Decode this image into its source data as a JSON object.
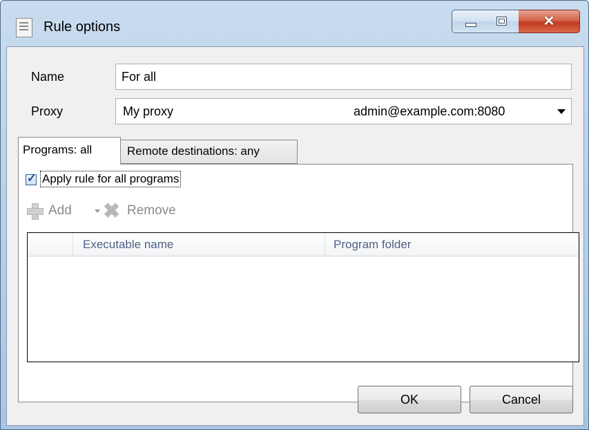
{
  "window": {
    "title": "Rule options"
  },
  "form": {
    "name_label": "Name",
    "name_value": "For all",
    "proxy_label": "Proxy",
    "proxy_name": "My proxy",
    "proxy_address": "admin@example.com:8080"
  },
  "tabs": [
    {
      "label": "Programs: all",
      "active": true
    },
    {
      "label": "Remote destinations: any",
      "active": false
    }
  ],
  "programs": {
    "apply_all_label": "Apply rule for all programs",
    "apply_all_checked": true,
    "toolbar": {
      "add_label": "Add",
      "remove_label": "Remove"
    },
    "columns": [
      "Executable name",
      "Program folder"
    ],
    "rows": []
  },
  "buttons": {
    "ok": "OK",
    "cancel": "Cancel"
  },
  "colors": {
    "title_bar": "#bcd2e9",
    "close_button": "#c23a21",
    "client_bg": "#f0f0f0",
    "grid_header_text": "#4d6082"
  }
}
